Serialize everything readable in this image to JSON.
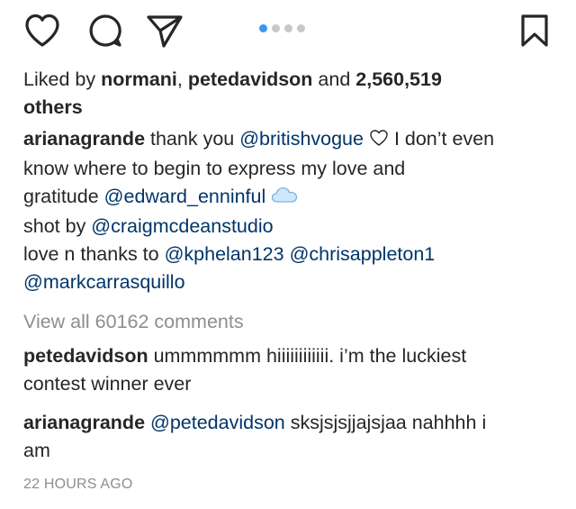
{
  "actions": {
    "like_icon": "heart-icon",
    "comment_icon": "comment-bubble-icon",
    "share_icon": "paper-plane-icon",
    "save_icon": "bookmark-icon",
    "carousel_dots": 4,
    "carousel_active_index": 0,
    "active_dot_color": "#3897f0"
  },
  "likes": {
    "prefix": "Liked by ",
    "user1": "normani",
    "separator": ", ",
    "user2": "petedavidson",
    "conjunction": " and ",
    "count": "2,560,519",
    "suffix": "others"
  },
  "caption": {
    "username": "arianagrande",
    "line1_text": " thank you ",
    "line1_mention": "@britishvogue",
    "line1_after": " I don’t even",
    "line2": "know where to begin to express my love and",
    "line3_text": "gratitude ",
    "line3_mention": "@edward_enninful",
    "line4_text": "shot by ",
    "line4_mention": "@craigmcdeanstudio",
    "line5_text": "love n thanks to ",
    "line5_mention1": "@kphelan123",
    "line5_space": " ",
    "line5_mention2": "@chrisappleton1",
    "line6_mention": "@markcarrasquillo",
    "heart_emoji_icon": "white-heart-icon",
    "cloud_emoji_icon": "cloud-icon"
  },
  "view_all_comments": "View all 60162 comments",
  "comments": [
    {
      "username": "petedavidson",
      "text_line1": " ummmmmm hiiiiiiiiiiii. i’m the luckiest",
      "text_line2": "contest winner ever"
    },
    {
      "username": "arianagrande",
      "mention": "@petedavidson",
      "text_line1": " sksjsjsjjajsjaa  nahhhh i",
      "text_line2": "am"
    }
  ],
  "timestamp": "22 HOURS AGO",
  "colors": {
    "text": "#262626",
    "mention": "#003569",
    "muted": "#8e8e8e"
  }
}
